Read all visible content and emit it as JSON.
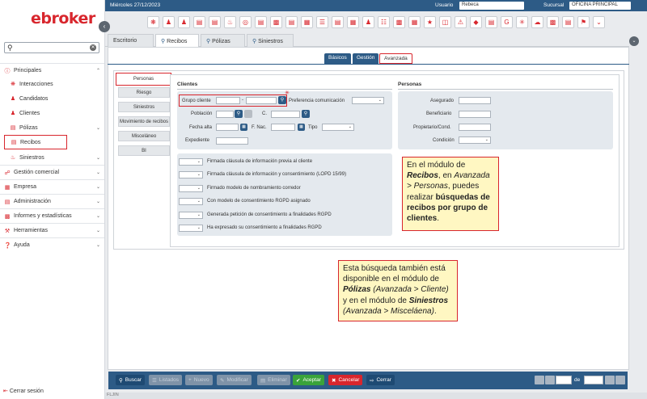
{
  "logo": "ebroker",
  "sidebar": {
    "items": [
      {
        "label": "Principales",
        "icon": "info-circle-icon"
      },
      {
        "label": "Interacciones",
        "icon": "interactions-icon"
      },
      {
        "label": "Candidatos",
        "icon": "candidates-icon"
      },
      {
        "label": "Clientes",
        "icon": "clients-icon"
      },
      {
        "label": "Pólizas",
        "icon": "policy-icon"
      },
      {
        "label": "Recibos",
        "icon": "receipt-icon"
      },
      {
        "label": "Siniestros",
        "icon": "fire-icon"
      },
      {
        "label": "Gestión comercial",
        "icon": "commercial-icon"
      },
      {
        "label": "Empresa",
        "icon": "company-icon"
      },
      {
        "label": "Administración",
        "icon": "admin-icon"
      },
      {
        "label": "Informes y estadísticas",
        "icon": "stats-icon"
      },
      {
        "label": "Herramientas",
        "icon": "tools-icon"
      },
      {
        "label": "Ayuda",
        "icon": "help-icon"
      }
    ],
    "logout": "Cerrar sesión"
  },
  "topbar": {
    "date": "Miércoles 27/12/2023",
    "usuario_label": "Usuario",
    "usuario_value": "Rebeca",
    "sucursal_label": "Sucursal",
    "sucursal_value": "OFICINA PRINCIPAL"
  },
  "module_tabs": [
    "Escritorio",
    "Recibos",
    "Pólizas",
    "Siniestros"
  ],
  "sub_tabs": [
    "Básicos",
    "Gestión",
    "Avanzada"
  ],
  "left_tabs": [
    "Personas",
    "Riesgo",
    "Siniestros",
    "Movimiento de recibos",
    "Misceláneo",
    "BI"
  ],
  "clientes": {
    "title": "Clientes",
    "grupo_cliente": "Grupo cliente",
    "grupo_sep": "-",
    "preferencia": "Preferencia comunicación",
    "poblacion": "Población",
    "c": "C.",
    "fecha_alta": "Fecha alta",
    "f_nac": "F. Nac.",
    "tipo": "Tipo",
    "expediente": "Expediente"
  },
  "personas": {
    "title": "Personas",
    "asegurado": "Asegurado",
    "beneficiario": "Beneficiario",
    "propietario": "Propietario/Cond.",
    "condicion": "Condición"
  },
  "consents": [
    "Firmada cláusula de información previa al cliente",
    "Firmada cláusula de información y consentimiento (LOPD 15/99)",
    "Firmado modelo de nombramiento corredor",
    "Con modelo de consentimiento RGPD asignado",
    "Generada petición de consentimiento a finalidades RGPD",
    "Ha expresado su consentimiento a finalidades RGPD"
  ],
  "callout1": {
    "p1": "En el módulo de ",
    "recibos": "Recibos",
    "p2": ", en ",
    "path": "Avanzada > Personas",
    "p3": ", puedes realizar ",
    "bold": "búsquedas de recibos por grupo de clientes",
    "p4": "."
  },
  "callout2": {
    "p1": "Esta búsqueda también está disponible en el módulo de ",
    "polizas": "Pólizas",
    "path1": "(Avanzada > Cliente)",
    "p2": " y en el módulo de ",
    "siniestros": "Siniestros",
    "path2": "(Avanzada > Misceláena)",
    "p3": "."
  },
  "actions": {
    "buscar": "Buscar",
    "listados": "Listados",
    "nuevo": "Nuevo",
    "modificar": "Modificar",
    "eliminar": "Eliminar",
    "aceptar": "Aceptar",
    "cancelar": "Cancelar",
    "cerrar": "Cerrar",
    "de": "de"
  },
  "status": "FLJIN",
  "colors": {
    "brand": "#d8262d",
    "primary": "#2d5b86"
  }
}
